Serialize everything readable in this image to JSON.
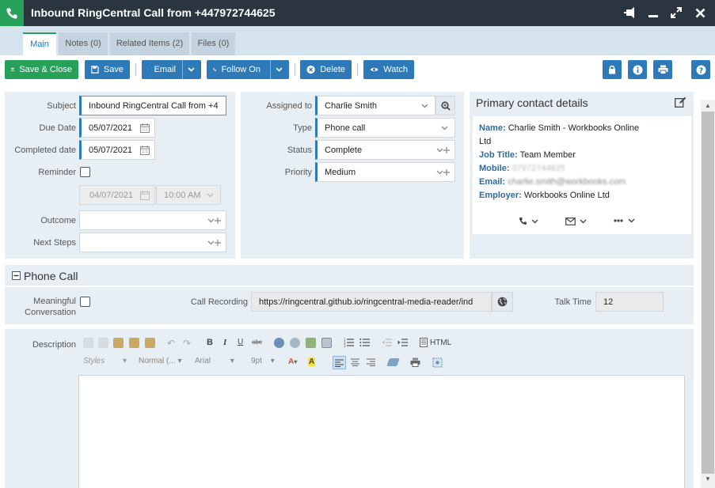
{
  "window": {
    "title": "Inbound RingCentral Call from +447972744625",
    "controls": [
      "pin-icon",
      "minimize-icon",
      "maximize-icon",
      "close-icon"
    ]
  },
  "tabs": [
    {
      "label": "Main",
      "active": true
    },
    {
      "label": "Notes (0)",
      "active": false
    },
    {
      "label": "Related Items (2)",
      "active": false
    },
    {
      "label": "Files (0)",
      "active": false
    }
  ],
  "toolbar": {
    "save_close": "Save & Close",
    "save": "Save",
    "email": "Email",
    "follow_on": "Follow On",
    "delete": "Delete",
    "watch": "Watch",
    "right_icons": [
      "lock-icon",
      "info-icon",
      "print-icon",
      "help-icon"
    ]
  },
  "form": {
    "subject_label": "Subject",
    "subject_value": "Inbound RingCentral Call from +4",
    "due_date_label": "Due Date",
    "due_date_value": "05/07/2021",
    "completed_date_label": "Completed date",
    "completed_date_value": "05/07/2021",
    "reminder_label": "Reminder",
    "reminder_checked": false,
    "reminder_date": "04/07/2021",
    "reminder_time": "10:00 AM",
    "outcome_label": "Outcome",
    "outcome_value": "",
    "next_steps_label": "Next Steps",
    "next_steps_value": "",
    "assigned_to_label": "Assigned to",
    "assigned_to_value": "Charlie Smith",
    "type_label": "Type",
    "type_value": "Phone call",
    "status_label": "Status",
    "status_value": "Complete",
    "priority_label": "Priority",
    "priority_value": "Medium"
  },
  "contact": {
    "heading": "Primary contact details",
    "name_label": "Name:",
    "name_value": "Charlie Smith - Workbooks Online",
    "name_value_2": "Ltd",
    "job_title_label": "Job Title:",
    "job_title_value": "Team Member",
    "mobile_label": "Mobile:",
    "mobile_value": "07972744625",
    "email_label": "Email:",
    "email_value": "charlie.smith@workbooks.com",
    "employer_label": "Employer:",
    "employer_value": "Workbooks Online Ltd"
  },
  "phone_call": {
    "heading": "Phone Call",
    "meaningful_label_1": "Meaningful",
    "meaningful_label_2": "Conversation",
    "meaningful_checked": false,
    "recording_label": "Call Recording",
    "recording_value": "https://ringcentral.github.io/ringcentral-media-reader/ind",
    "talk_time_label": "Talk Time",
    "talk_time_value": "12"
  },
  "editor": {
    "description_label": "Description",
    "html_label": "HTML",
    "styles": "Styles",
    "format": "Normal (...",
    "font": "Arial",
    "size": "9pt",
    "content": ""
  },
  "colors": {
    "titlebar": "#2a3540",
    "accent_green": "#27a05a",
    "button_blue": "#2e7ab8",
    "panel_bg": "#e7eef4",
    "tab_strip": "#d5e3ef"
  }
}
